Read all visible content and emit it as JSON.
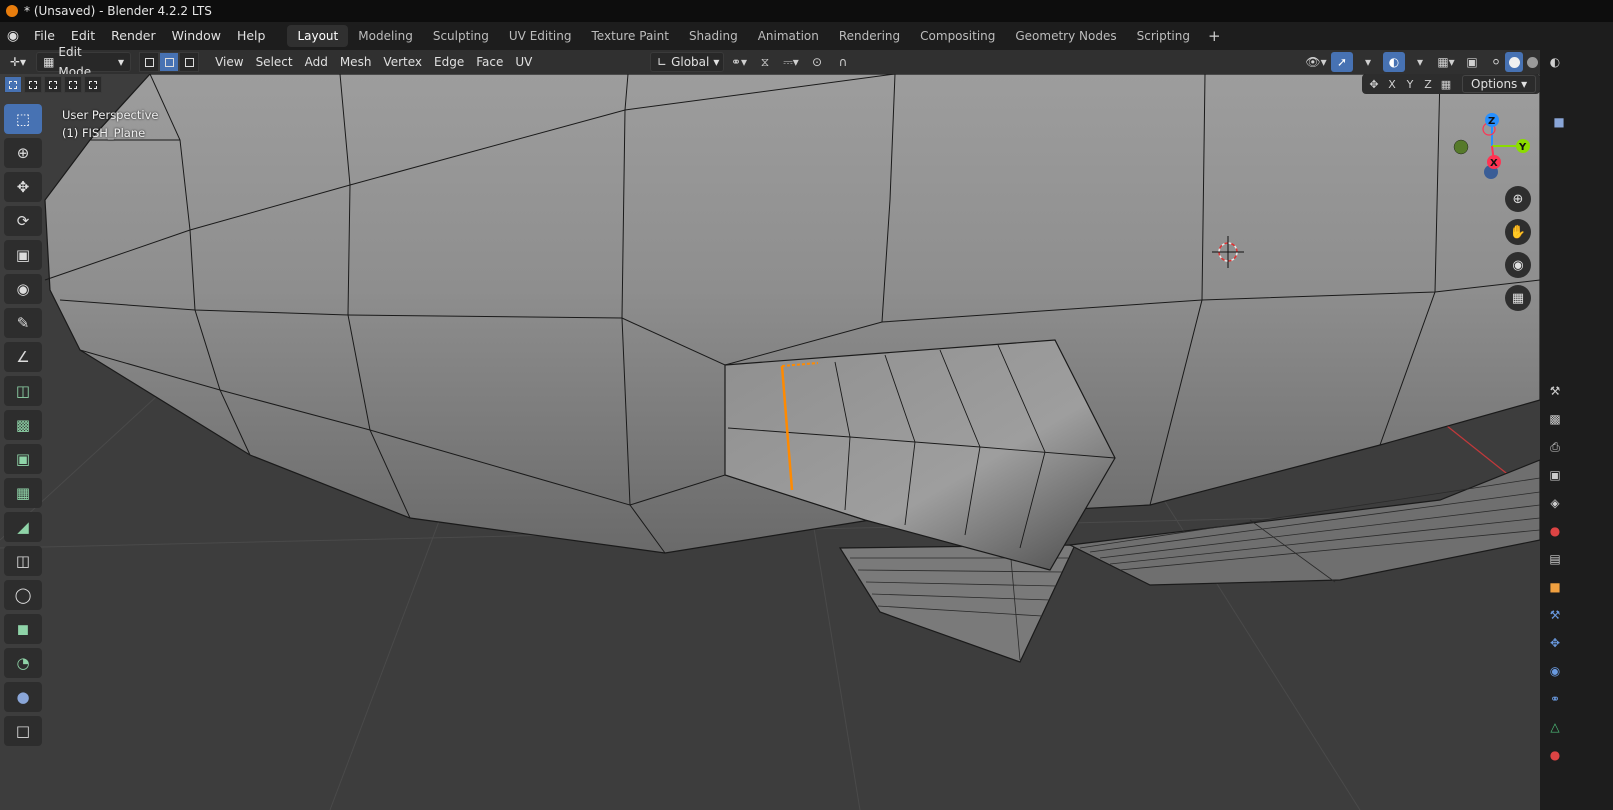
{
  "window": {
    "title": "* (Unsaved) - Blender 4.2.2 LTS"
  },
  "menubar": {
    "items": [
      "File",
      "Edit",
      "Render",
      "Window",
      "Help"
    ],
    "workspaces": [
      "Layout",
      "Modeling",
      "Sculpting",
      "UV Editing",
      "Texture Paint",
      "Shading",
      "Animation",
      "Rendering",
      "Compositing",
      "Geometry Nodes",
      "Scripting"
    ],
    "active_workspace": "Layout",
    "add_label": "+"
  },
  "header": {
    "mode": "Edit Mode",
    "menus": [
      "View",
      "Select",
      "Add",
      "Mesh",
      "Vertex",
      "Edge",
      "Face",
      "UV"
    ],
    "transform_orientation": "Global",
    "select_mode_active": "edge"
  },
  "viewport": {
    "perspective_label": "User Perspective",
    "object_label": "(1) FISH_Plane",
    "axis_buttons": [
      "X",
      "Y",
      "Z"
    ],
    "options_label": "Options",
    "gizmo": {
      "x_label": "X",
      "y_label": "Y",
      "z_label": "Z"
    }
  },
  "colors": {
    "accent": "#4772b3",
    "selected_edge": "#ff8a00",
    "x_axis": "#ff3352",
    "y_axis": "#8bdc00",
    "z_axis": "#2890ff"
  },
  "toolbar": {
    "tools": [
      "select-box",
      "cursor",
      "move",
      "rotate",
      "scale",
      "transform",
      "annotate",
      "measure",
      "add-cube",
      "extrude-region",
      "inset-faces",
      "bevel",
      "loop-cut",
      "knife",
      "poly-build",
      "spin",
      "smooth",
      "shrink-fatten",
      "shear"
    ]
  }
}
